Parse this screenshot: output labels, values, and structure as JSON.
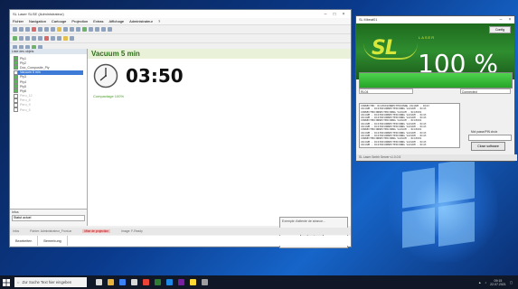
{
  "main_window": {
    "title": "SL Laser SLSE (Administrateur)",
    "menu": [
      "Fichier",
      "Navigation",
      "Cartouge",
      "Projection",
      "Extras",
      "Affichage",
      "Administrateur",
      "?"
    ],
    "tree_header": "Liste des objets",
    "tree": [
      {
        "label": "Ply1",
        "state": "on"
      },
      {
        "label": "Ply2",
        "state": "on"
      },
      {
        "label": "Doc_Composite_Ply",
        "state": "on"
      },
      {
        "label": "Vacuum 5 min",
        "state": "sel"
      },
      {
        "label": "Ply3",
        "state": "on"
      },
      {
        "label": "Ply4",
        "state": "on"
      },
      {
        "label": "Ply5",
        "state": "on"
      },
      {
        "label": "Ply6",
        "state": "on"
      },
      {
        "label": "Peru_12",
        "state": "dim"
      },
      {
        "label": "Peru_8",
        "state": "dim"
      },
      {
        "label": "Peru_9",
        "state": "dim"
      },
      {
        "label": "Peru_5",
        "state": "dim"
      }
    ],
    "bottom_label": "Infos",
    "bottom_select": "Statut actuel",
    "vacuum_title": "Vacuum 5 min",
    "timer": "03:50",
    "pump_text": "Compactage 100%",
    "status1": [
      "Infos",
      "Fichier: Administrateur_Front.ar",
      "Mise de projection",
      "Image: F-Ready"
    ],
    "status2": [
      "Bearbeiten",
      "Bemerkung"
    ],
    "dialog_text": "Exemple d'attente de séance...",
    "dialog_button": "Annuler"
  },
  "laser_window": {
    "title": "SL Mbeat01",
    "logo": "SL",
    "logo_sub": "LASER",
    "config_button": "Config",
    "percent": "100 %",
    "progress": 1.0,
    "field1": "RL04",
    "field2": "Connected",
    "log_lines": [
      "CONNECTED: RC43601ONNECTEDCONNG VACUUM - RC43",
      "VACUUM - RC43601ONNECTEDCONNG VACUUM - RC43",
      "CONNECTEDCONNECTEDCONNG VACUUM - RC43601",
      "VACUUM - RC43601ONNECTEDCONNG VACUUM - RC43",
      "VACUUM - RC43601ONNECTEDCONNG VACUUM - RC43",
      "CONNECTEDCONNECTEDCONNG VACUUM - RC43601",
      "VACUUM - RC43601ONNECTEDCONNG VACUUM - RC43",
      "VACUUM - RC43601ONNECTEDCONNG VACUUM - RC43",
      "CONNECTEDCONNECTEDCONNG VACUUM - RC43601",
      "VACUUM - RC43601ONNECTEDCONNG VACUUM - RC43",
      "VACUUM - RC43601ONNECTEDCONNG VACUUM - RC43",
      "CONNECTEDCONNECTEDCONNG VACUUM - RC43601",
      "VACUUM - RC43601ONNECTEDCONNG VACUUM - RC43",
      "VACUUM - RC43601ONNECTEDCONNG VACUUM - RC43"
    ],
    "password_label": "Mot passe/PIN choix",
    "close_button": "Close software",
    "status": "SL Laser Gmbh Server v1.0.0.5"
  },
  "taskbar": {
    "search_placeholder": "Zur Suche Text hier eingeben",
    "time": "09:15",
    "date": "22.07.2021"
  },
  "colors": {
    "laser_green": "#2f8e2f",
    "progress": "#25a325",
    "selection": "#3d7bd6"
  }
}
